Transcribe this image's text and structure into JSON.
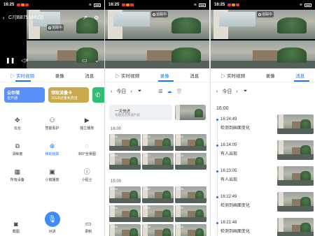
{
  "status": {
    "time": "16:25",
    "battery_icon": "battery-icon"
  },
  "panel1": {
    "title": "C7(BB7514423)",
    "rec_badge": "追踪中",
    "tabs": [
      "实时视频",
      "录像",
      "消息"
    ],
    "cards": [
      {
        "title": "云存储",
        "sub": "去开通"
      },
      {
        "title": "领取流量卡",
        "sub": "10GB流量免费送"
      }
    ],
    "grid": [
      {
        "label": "云台",
        "icon": "ptz-icon"
      },
      {
        "label": "智能看护",
        "icon": "care-icon"
      },
      {
        "label": "独立播放",
        "icon": "play-icon"
      },
      {
        "label": "清晰度",
        "icon": "hd-icon"
      },
      {
        "label": "移动追踪",
        "icon": "tracking-icon"
      },
      {
        "label": "360°全景图",
        "icon": "panorama-icon"
      },
      {
        "label": "所有设备",
        "icon": "devices-icon"
      },
      {
        "label": "小窗播放",
        "icon": "pip-icon"
      },
      {
        "label": "小贴士",
        "icon": "tips-icon"
      }
    ],
    "bottom": [
      {
        "label": "截图"
      },
      {
        "label": "对讲"
      },
      {
        "label": "录制"
      }
    ]
  },
  "panel2": {
    "tabs": [
      "实时视频",
      "录像",
      "消息"
    ],
    "today": "今日",
    "seg_title": "一天快进",
    "seg_sub": "有趣延迟快放片段",
    "hour1": "16:00",
    "hour2": "15:00",
    "thumbs1": [
      "16:24",
      "16:22",
      "16:21",
      "16:19",
      "16:17",
      "16:16"
    ],
    "thumbs2": [
      "15:59",
      "15:57",
      "15:56",
      "15:54",
      "15:52",
      "15:50",
      "15:48",
      "15:46",
      "15:44"
    ]
  },
  "panel3": {
    "tabs": [
      "实时视频",
      "录像",
      "消息"
    ],
    "today": "今日",
    "hour": "16:00",
    "messages": [
      {
        "time": "16:24:49",
        "text": "检测到画面变化"
      },
      {
        "time": "16:24:05",
        "text": "有人出现"
      },
      {
        "time": "16:23:05",
        "text": "有人出现"
      },
      {
        "time": "16:22:49",
        "text": "检测到画面变化"
      },
      {
        "time": "16:21:48",
        "text": "检测到画面变化"
      }
    ]
  },
  "colors": {
    "accent": "#1677ff",
    "cloud": "#5b8ff9",
    "flow": "#c9a94a",
    "call": "#2fbf71"
  }
}
